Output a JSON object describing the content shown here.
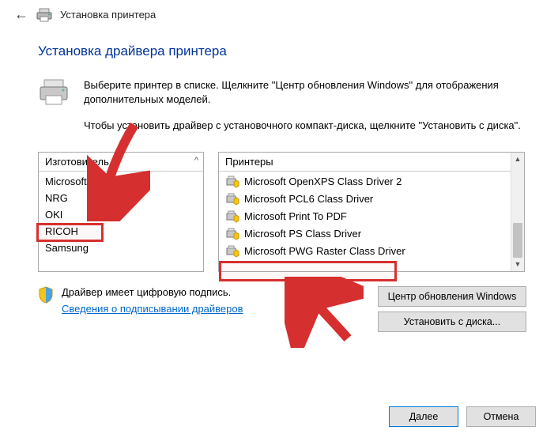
{
  "header": {
    "title": "Установка принтера"
  },
  "page_title": "Установка драйвера принтера",
  "intro1": "Выберите принтер в списке. Щелкните \"Центр обновления Windows\" для отображения дополнительных моделей.",
  "intro2": "Чтобы установить драйвер с установочного компакт-диска, щелкните \"Установить с диска\".",
  "manufacturer": {
    "header": "Изготовитель",
    "items": [
      "Microsoft",
      "NRG",
      "OKI",
      "RICOH",
      "Samsung"
    ],
    "selected_index": 0
  },
  "printers": {
    "header": "Принтеры",
    "items": [
      "Microsoft OpenXPS Class Driver 2",
      "Microsoft PCL6 Class Driver",
      "Microsoft Print To PDF",
      "Microsoft PS Class Driver",
      "Microsoft PWG Raster Class Driver"
    ],
    "selected_index": 2
  },
  "signature": {
    "text": "Драйвер имеет цифровую подпись.",
    "link": "Сведения о подписывании драйверов"
  },
  "buttons": {
    "windows_update": "Центр обновления Windows",
    "have_disk": "Установить с диска...",
    "next": "Далее",
    "cancel": "Отмена"
  }
}
